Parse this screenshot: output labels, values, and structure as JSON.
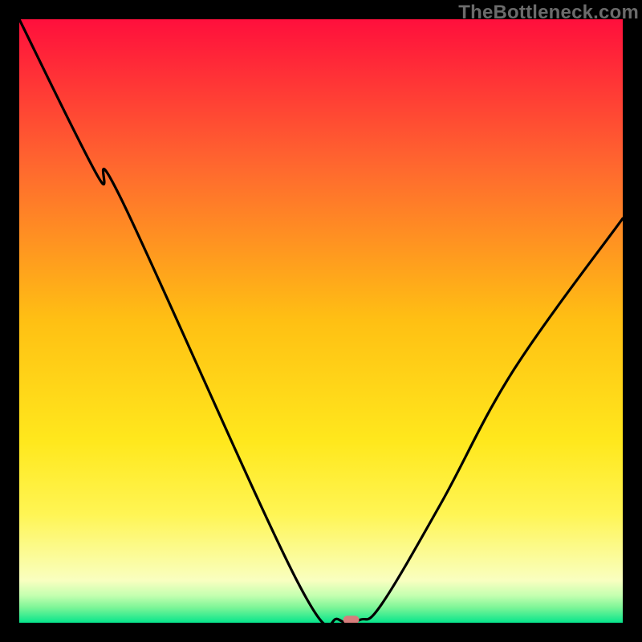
{
  "watermark": "TheBottleneck.com",
  "chart_data": {
    "type": "line",
    "title": "",
    "xlabel": "",
    "ylabel": "",
    "xlim": [
      0,
      100
    ],
    "ylim": [
      0,
      100
    ],
    "x": [
      0,
      13,
      17,
      46,
      53,
      56.5,
      60,
      70,
      82,
      100
    ],
    "values": [
      100,
      74,
      70,
      7,
      0.5,
      0.5,
      3,
      20,
      42,
      67
    ],
    "marker": {
      "x": 55,
      "y": 0.5,
      "color": "#d77d7c"
    },
    "gradient_stops": [
      {
        "offset": 0,
        "color": "#ff0f3c"
      },
      {
        "offset": 0.25,
        "color": "#ff6a2e"
      },
      {
        "offset": 0.5,
        "color": "#ffc013"
      },
      {
        "offset": 0.7,
        "color": "#ffe81d"
      },
      {
        "offset": 0.82,
        "color": "#fff554"
      },
      {
        "offset": 0.93,
        "color": "#f9ffc0"
      },
      {
        "offset": 0.955,
        "color": "#c4ffb0"
      },
      {
        "offset": 0.975,
        "color": "#7cf597"
      },
      {
        "offset": 1.0,
        "color": "#06e58c"
      }
    ]
  }
}
